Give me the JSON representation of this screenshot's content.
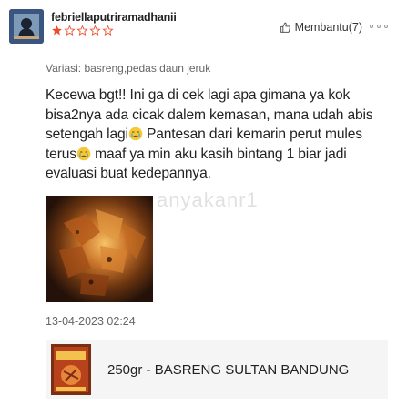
{
  "review": {
    "username": "febriellaputriramadhanii",
    "rating": 1,
    "max_rating": 5,
    "helpful_label": "Membantu(7)",
    "variation": "Variasi: basreng,pedas daun jeruk",
    "text_parts": [
      "Kecewa bgt!! Ini ga di cek lagi apa gimana ya kok bisa2nya ada cicak dalem kemasan, mana udah abis setengah lagi",
      " Pantesan dari kemarin perut mules terus",
      " maaf ya min aku kasih bintang 1 biar jadi evaluasi buat kedepannya."
    ],
    "emoji_icon": "crying-face-emoji-icon",
    "photo_watermark": "anyakanr1",
    "timestamp": "13-04-2023 02:24"
  },
  "product": {
    "name": "250gr - BASRENG SULTAN BANDUNG"
  },
  "colors": {
    "star_filled": "#ee4d2d",
    "star_empty": "#ee4d2d",
    "product_bg": "#f5f5f5",
    "muted_text": "#666666"
  }
}
